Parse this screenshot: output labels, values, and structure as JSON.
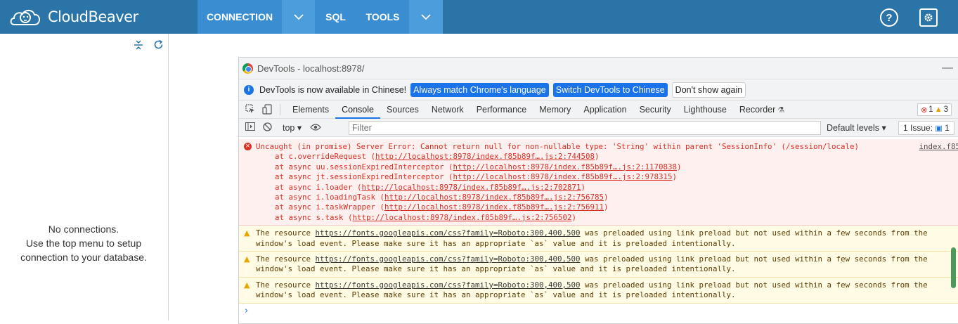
{
  "app": {
    "name_part1": "Cloud",
    "name_part2": "Beaver"
  },
  "nav": {
    "connection": "CONNECTION",
    "sql": "SQL",
    "tools": "TOOLS",
    "help": "?"
  },
  "left_panel": {
    "line1": "No connections.",
    "line2": "Use the top menu to setup",
    "line3": "connection to your database."
  },
  "devtools": {
    "title": "DevTools - localhost:8978/",
    "infobar": {
      "message": "DevTools is now available in Chinese!",
      "btn_match": "Always match Chrome's language",
      "btn_switch": "Switch DevTools to Chinese",
      "btn_dismiss": "Don't show again"
    },
    "tabs": [
      "Elements",
      "Console",
      "Sources",
      "Network",
      "Performance",
      "Memory",
      "Application",
      "Security",
      "Lighthouse",
      "Recorder"
    ],
    "badges": {
      "errors": "1",
      "warnings": "3"
    },
    "filterbar": {
      "context": "top",
      "filter_placeholder": "Filter",
      "levels": "Default levels",
      "issues": "1 Issue:",
      "issues_count": "1"
    },
    "console": {
      "error": {
        "text": "Uncaught (in promise) Server Error: Cannot return null for non-nullable type: 'String' within parent 'SessionInfo' (/session/locale)",
        "source": "index.f85",
        "stack": [
          {
            "prefix": "at c.overrideRequest (",
            "link": "http://localhost:8978/index.f85b89f….js:2:744508",
            "suffix": ")"
          },
          {
            "prefix": "at async uu.sessionExpiredInterceptor (",
            "link": "http://localhost:8978/index.f85b89f….js:2:1170838",
            "suffix": ")"
          },
          {
            "prefix": "at async jt.sessionExpiredInterceptor (",
            "link": "http://localhost:8978/index.f85b89f….js:2:978315",
            "suffix": ")"
          },
          {
            "prefix": "at async i.loader (",
            "link": "http://localhost:8978/index.f85b89f….js:2:702871",
            "suffix": ")"
          },
          {
            "prefix": "at async i.loadingTask (",
            "link": "http://localhost:8978/index.f85b89f….js:2:756785",
            "suffix": ")"
          },
          {
            "prefix": "at async i.taskWrapper (",
            "link": "http://localhost:8978/index.f85b89f….js:2:756911",
            "suffix": ")"
          },
          {
            "prefix": "at async s.task (",
            "link": "http://localhost:8978/index.f85b89f….js:2:756502",
            "suffix": ")"
          }
        ]
      },
      "warnings": [
        {
          "prefix": "The resource ",
          "link": "https://fonts.googleapis.com/css?family=Roboto:300,400,500",
          "line1_suffix": " was preloaded using link preload but not used within a few seconds from the",
          "line2": "window's load event. Please make sure it has an appropriate `as` value and it is preloaded intentionally."
        },
        {
          "prefix": "The resource ",
          "link": "https://fonts.googleapis.com/css?family=Roboto:300,400,500",
          "line1_suffix": " was preloaded using link preload but not used within a few seconds from the",
          "line2": "window's load event. Please make sure it has an appropriate `as` value and it is preloaded intentionally."
        },
        {
          "prefix": "The resource ",
          "link": "https://fonts.googleapis.com/css?family=Roboto:300,400,500",
          "line1_suffix": " was preloaded using link preload but not used within a few seconds from the",
          "line2": "window's load event. Please make sure it has an appropriate `as` value and it is preloaded intentionally."
        }
      ],
      "prompt": "›"
    }
  },
  "colors": {
    "topbar": "#2a74a8",
    "nav_active": "#3a8dd0",
    "devtools_blue": "#1a73e8",
    "error_red": "#d93025"
  },
  "icons": {
    "logo": "beaver-cloud-icon",
    "help": "help-icon",
    "settings": "gear-icon",
    "collapse": "collapse-all-icon",
    "refresh": "refresh-icon"
  }
}
